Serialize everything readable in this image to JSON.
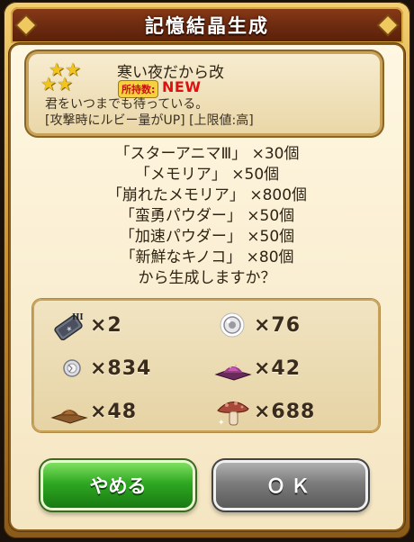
{
  "dialog": {
    "title": "記憶結晶生成"
  },
  "item": {
    "name": "寒い夜だから改",
    "owned_label": "所持数:",
    "owned_value": "NEW",
    "description": "君をいつまでも待っている。",
    "effect": "[攻撃時にルビー量がUP] [上限値:高]",
    "rarity_icon": "three-stars"
  },
  "confirmation": {
    "lines": [
      "「スターアニマⅢ」 ×30個",
      "「メモリア」 ×50個",
      "「崩れたメモリア」 ×800個",
      "「蛮勇パウダー」 ×50個",
      "「加速パウダー」 ×50個",
      "「新鮮なキノコ」 ×80個",
      "から生成しますか？"
    ]
  },
  "materials": [
    {
      "icon": "star-anima-iii-icon",
      "count": "×2"
    },
    {
      "icon": "memoria-icon",
      "count": "×76"
    },
    {
      "icon": "broken-memoria-icon",
      "count": "×834"
    },
    {
      "icon": "valor-powder-icon",
      "count": "×42"
    },
    {
      "icon": "speed-powder-icon",
      "count": "×48"
    },
    {
      "icon": "mushroom-icon",
      "count": "×688"
    }
  ],
  "buttons": {
    "cancel": "やめる",
    "ok": "ＯＫ"
  },
  "colors": {
    "cancel": "#2fa822",
    "ok": "#7c7c7c",
    "owned_value": "#e01010"
  }
}
